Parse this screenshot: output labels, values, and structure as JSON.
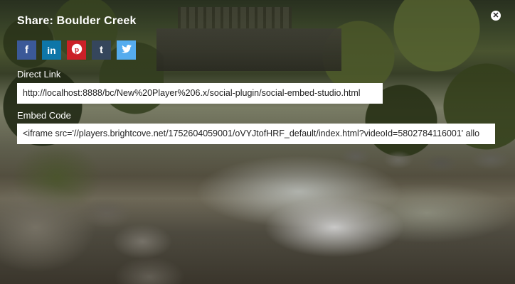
{
  "dialog": {
    "title": "Share: Boulder Creek",
    "close_glyph": "✕"
  },
  "social": [
    {
      "name": "facebook-icon",
      "glyph": "f",
      "color": "#3b5998"
    },
    {
      "name": "linkedin-icon",
      "glyph": "in",
      "color": "#0e76a8"
    },
    {
      "name": "pinterest-icon",
      "glyph": "P",
      "color": "#cb2027"
    },
    {
      "name": "tumblr-icon",
      "glyph": "t",
      "color": "#35465c"
    },
    {
      "name": "twitter-icon",
      "glyph": "twitter",
      "color": "#55acee"
    }
  ],
  "direct_link": {
    "label": "Direct Link",
    "value": "http://localhost:8888/bc/New%20Player%206.x/social-plugin/social-embed-studio.html"
  },
  "embed_code": {
    "label": "Embed Code",
    "value": "<iframe src='//players.brightcove.net/1752604059001/oVYJtofHRF_default/index.html?videoId=5802784116001' allo"
  },
  "colors": {
    "text": "#ffffff",
    "field_bg": "#ffffff"
  }
}
